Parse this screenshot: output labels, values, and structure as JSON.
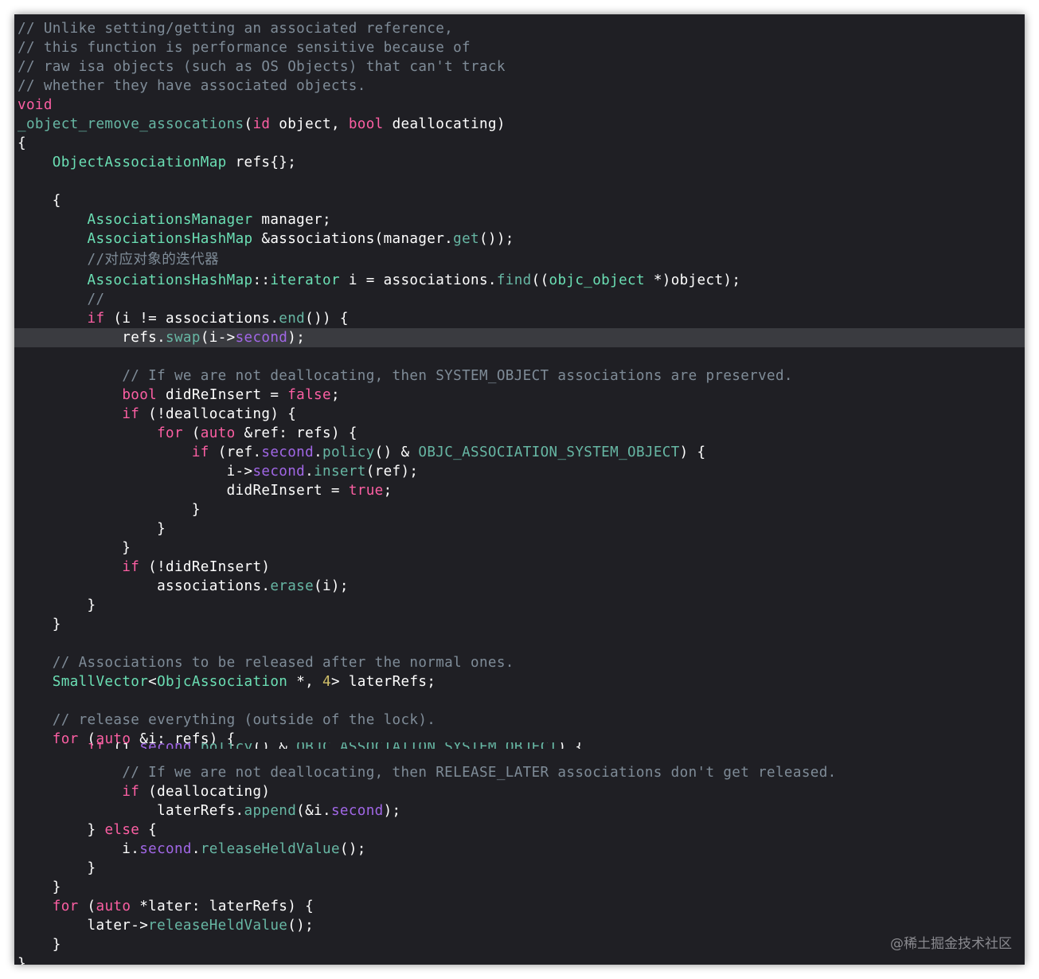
{
  "lines": [
    [
      {
        "t": "// Unlike setting/getting an associated reference,",
        "c": "cmt"
      }
    ],
    [
      {
        "t": "// this function is performance sensitive because of",
        "c": "cmt"
      }
    ],
    [
      {
        "t": "// raw isa objects (such as OS Objects) that can't track",
        "c": "cmt"
      }
    ],
    [
      {
        "t": "// whether they have associated objects.",
        "c": "cmt"
      }
    ],
    [
      {
        "t": "void",
        "c": "kw"
      }
    ],
    [
      {
        "t": "_object_remove_assocations",
        "c": "fn"
      },
      {
        "t": "(",
        "c": "pl"
      },
      {
        "t": "id",
        "c": "kw"
      },
      {
        "t": " object, ",
        "c": "pl"
      },
      {
        "t": "bool",
        "c": "kw"
      },
      {
        "t": " deallocating)",
        "c": "pl"
      }
    ],
    [
      {
        "t": "{",
        "c": "pl"
      }
    ],
    [
      {
        "t": "    ",
        "c": "pl"
      },
      {
        "t": "ObjectAssociationMap",
        "c": "pr"
      },
      {
        "t": " refs{};",
        "c": "pl"
      }
    ],
    [],
    [
      {
        "t": "    {",
        "c": "pl"
      }
    ],
    [
      {
        "t": "        ",
        "c": "pl"
      },
      {
        "t": "AssociationsManager",
        "c": "pr"
      },
      {
        "t": " manager;",
        "c": "pl"
      }
    ],
    [
      {
        "t": "        ",
        "c": "pl"
      },
      {
        "t": "AssociationsHashMap",
        "c": "pr"
      },
      {
        "t": " &associations(manager.",
        "c": "pl"
      },
      {
        "t": "get",
        "c": "fn"
      },
      {
        "t": "());",
        "c": "pl"
      }
    ],
    [
      {
        "t": "        ",
        "c": "pl"
      },
      {
        "t": "//对应对象的迭代器",
        "c": "cmt"
      }
    ],
    [
      {
        "t": "        ",
        "c": "pl"
      },
      {
        "t": "AssociationsHashMap",
        "c": "pr"
      },
      {
        "t": "::",
        "c": "pl"
      },
      {
        "t": "iterator",
        "c": "pr"
      },
      {
        "t": " i = associations.",
        "c": "pl"
      },
      {
        "t": "find",
        "c": "fn"
      },
      {
        "t": "((",
        "c": "pl"
      },
      {
        "t": "objc_object",
        "c": "pr"
      },
      {
        "t": " *)object);",
        "c": "pl"
      }
    ],
    [
      {
        "t": "        ",
        "c": "pl"
      },
      {
        "t": "//",
        "c": "cmt"
      }
    ],
    [
      {
        "t": "        ",
        "c": "pl"
      },
      {
        "t": "if",
        "c": "kw"
      },
      {
        "t": " (i != associations.",
        "c": "pl"
      },
      {
        "t": "end",
        "c": "fn"
      },
      {
        "t": "()) {",
        "c": "pl"
      }
    ],
    [
      {
        "t": "            refs.",
        "c": "pl"
      },
      {
        "t": "swap",
        "c": "fn"
      },
      {
        "t": "(i->",
        "c": "pl"
      },
      {
        "t": "second",
        "c": "mb"
      },
      {
        "t": ");",
        "c": "pl"
      }
    ],
    [],
    [
      {
        "t": "            ",
        "c": "pl"
      },
      {
        "t": "// If we are not deallocating, then SYSTEM_OBJECT associations are preserved.",
        "c": "cmt"
      }
    ],
    [
      {
        "t": "            ",
        "c": "pl"
      },
      {
        "t": "bool",
        "c": "kw"
      },
      {
        "t": " didReInsert = ",
        "c": "pl"
      },
      {
        "t": "false",
        "c": "kw"
      },
      {
        "t": ";",
        "c": "pl"
      }
    ],
    [
      {
        "t": "            ",
        "c": "pl"
      },
      {
        "t": "if",
        "c": "kw"
      },
      {
        "t": " (!deallocating) {",
        "c": "pl"
      }
    ],
    [
      {
        "t": "                ",
        "c": "pl"
      },
      {
        "t": "for",
        "c": "kw"
      },
      {
        "t": " (",
        "c": "pl"
      },
      {
        "t": "auto",
        "c": "kw"
      },
      {
        "t": " &ref: refs) {",
        "c": "pl"
      }
    ],
    [
      {
        "t": "                    ",
        "c": "pl"
      },
      {
        "t": "if",
        "c": "kw"
      },
      {
        "t": " (ref.",
        "c": "pl"
      },
      {
        "t": "second",
        "c": "mb"
      },
      {
        "t": ".",
        "c": "pl"
      },
      {
        "t": "policy",
        "c": "fn"
      },
      {
        "t": "() & ",
        "c": "pl"
      },
      {
        "t": "OBJC_ASSOCIATION_SYSTEM_OBJECT",
        "c": "fn"
      },
      {
        "t": ") {",
        "c": "pl"
      }
    ],
    [
      {
        "t": "                        i->",
        "c": "pl"
      },
      {
        "t": "second",
        "c": "mb"
      },
      {
        "t": ".",
        "c": "pl"
      },
      {
        "t": "insert",
        "c": "fn"
      },
      {
        "t": "(ref);",
        "c": "pl"
      }
    ],
    [
      {
        "t": "                        didReInsert = ",
        "c": "pl"
      },
      {
        "t": "true",
        "c": "kw"
      },
      {
        "t": ";",
        "c": "pl"
      }
    ],
    [
      {
        "t": "                    }",
        "c": "pl"
      }
    ],
    [
      {
        "t": "                }",
        "c": "pl"
      }
    ],
    [
      {
        "t": "            }",
        "c": "pl"
      }
    ],
    [
      {
        "t": "            ",
        "c": "pl"
      },
      {
        "t": "if",
        "c": "kw"
      },
      {
        "t": " (!didReInsert)",
        "c": "pl"
      }
    ],
    [
      {
        "t": "                associations.",
        "c": "pl"
      },
      {
        "t": "erase",
        "c": "fn"
      },
      {
        "t": "(i);",
        "c": "pl"
      }
    ],
    [
      {
        "t": "        }",
        "c": "pl"
      }
    ],
    [
      {
        "t": "    }",
        "c": "pl"
      }
    ],
    [],
    [
      {
        "t": "    ",
        "c": "pl"
      },
      {
        "t": "// Associations to be released after the normal ones.",
        "c": "cmt"
      }
    ],
    [
      {
        "t": "    ",
        "c": "pl"
      },
      {
        "t": "SmallVector",
        "c": "pr"
      },
      {
        "t": "<",
        "c": "pl"
      },
      {
        "t": "ObjcAssociation",
        "c": "pr"
      },
      {
        "t": " *, ",
        "c": "pl"
      },
      {
        "t": "4",
        "c": "nm"
      },
      {
        "t": "> laterRefs;",
        "c": "pl"
      }
    ],
    [],
    [
      {
        "t": "    ",
        "c": "pl"
      },
      {
        "t": "// release everything (outside of the lock).",
        "c": "cmt"
      }
    ],
    [
      {
        "t": "    ",
        "c": "pl"
      },
      {
        "t": "for",
        "c": "kw"
      },
      {
        "t": " (",
        "c": "pl"
      },
      {
        "t": "auto",
        "c": "kw"
      },
      {
        "t": " &i: refs) {",
        "c": "pl"
      }
    ],
    [
      {
        "t": "        ",
        "c": "pl"
      },
      {
        "t": "if",
        "c": "kw"
      },
      {
        "t": " (i.",
        "c": "pl"
      },
      {
        "t": "second",
        "c": "mb"
      },
      {
        "t": ".",
        "c": "pl"
      },
      {
        "t": "policy",
        "c": "fn"
      },
      {
        "t": "() & ",
        "c": "pl"
      },
      {
        "t": "OBJC_ASSOCIATION_SYSTEM_OBJECT",
        "c": "fn"
      },
      {
        "t": ") {",
        "c": "pl"
      }
    ],
    [
      {
        "t": "            ",
        "c": "pl"
      },
      {
        "t": "// If we are not deallocating, then RELEASE_LATER associations don't get released.",
        "c": "cmt"
      }
    ],
    [
      {
        "t": "            ",
        "c": "pl"
      },
      {
        "t": "if",
        "c": "kw"
      },
      {
        "t": " (deallocating)",
        "c": "pl"
      }
    ],
    [
      {
        "t": "                laterRefs.",
        "c": "pl"
      },
      {
        "t": "append",
        "c": "fn"
      },
      {
        "t": "(&i.",
        "c": "pl"
      },
      {
        "t": "second",
        "c": "mb"
      },
      {
        "t": ");",
        "c": "pl"
      }
    ],
    [
      {
        "t": "        } ",
        "c": "pl"
      },
      {
        "t": "else",
        "c": "kw"
      },
      {
        "t": " {",
        "c": "pl"
      }
    ],
    [
      {
        "t": "            i.",
        "c": "pl"
      },
      {
        "t": "second",
        "c": "mb"
      },
      {
        "t": ".",
        "c": "pl"
      },
      {
        "t": "releaseHeldValue",
        "c": "fn"
      },
      {
        "t": "();",
        "c": "pl"
      }
    ],
    [
      {
        "t": "        }",
        "c": "pl"
      }
    ],
    [
      {
        "t": "    }",
        "c": "pl"
      }
    ],
    [
      {
        "t": "    ",
        "c": "pl"
      },
      {
        "t": "for",
        "c": "kw"
      },
      {
        "t": " (",
        "c": "pl"
      },
      {
        "t": "auto",
        "c": "kw"
      },
      {
        "t": " *later: laterRefs) {",
        "c": "pl"
      }
    ],
    [
      {
        "t": "        later->",
        "c": "pl"
      },
      {
        "t": "releaseHeldValue",
        "c": "fn"
      },
      {
        "t": "();",
        "c": "pl"
      }
    ],
    [
      {
        "t": "    }",
        "c": "pl"
      }
    ],
    [
      {
        "t": "}",
        "c": "pl"
      }
    ]
  ],
  "watermark": "@稀土掘金技术社区"
}
